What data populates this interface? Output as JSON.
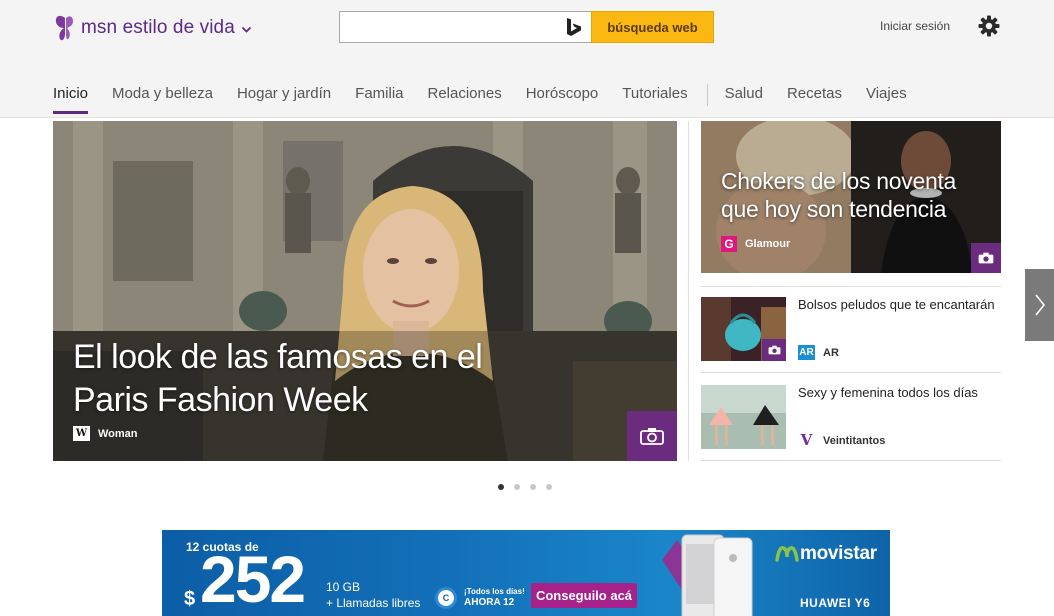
{
  "header": {
    "brand": "msn estilo de vida",
    "search": {
      "placeholder": "",
      "value": "",
      "button": "búsqueda web"
    },
    "signin": "Iniciar sesión"
  },
  "nav": {
    "items": [
      {
        "label": "Inicio",
        "active": true
      },
      {
        "label": "Moda y belleza",
        "active": false
      },
      {
        "label": "Hogar y jardín",
        "active": false
      },
      {
        "label": "Familia",
        "active": false
      },
      {
        "label": "Relaciones",
        "active": false
      },
      {
        "label": "Horóscopo",
        "active": false
      },
      {
        "label": "Tutoriales",
        "active": false
      },
      {
        "label": "Salud",
        "active": false
      },
      {
        "label": "Recetas",
        "active": false
      },
      {
        "label": "Viajes",
        "active": false
      }
    ]
  },
  "hero": {
    "title": "El look de las famosas en el Paris Fashion Week",
    "source": "Woman",
    "source_logo": "W",
    "badge_icon": "camera-icon"
  },
  "feature": {
    "title": "Chokers de los noventa que hoy son tendencia",
    "source": "Glamour",
    "source_logo": "G"
  },
  "cards": [
    {
      "title": "Bolsos peludos que te encantarán",
      "source": "AR",
      "source_logo": "AR",
      "has_gallery": true
    },
    {
      "title": "Sexy y femenina todos los días",
      "source": "Veintitantos",
      "source_logo": "V",
      "has_gallery": false
    }
  ],
  "carousel": {
    "pages": 4,
    "active": 1
  },
  "ad": {
    "cuotas": "12 cuotas de",
    "dollar": "$",
    "amount": "252",
    "gb": "10 GB",
    "llamadas": "+ Llamadas libres",
    "c_logo": "C",
    "todos": "¡Todos los días!",
    "ahora": "AHORA 12",
    "cta": "Conseguilo acá",
    "brand": "movistar",
    "phone": "HUAWEI Y6"
  },
  "colors": {
    "brand_purple": "#5d2a84",
    "search_yellow": "#fbb812",
    "badge_purple": "#6b2c7f"
  }
}
